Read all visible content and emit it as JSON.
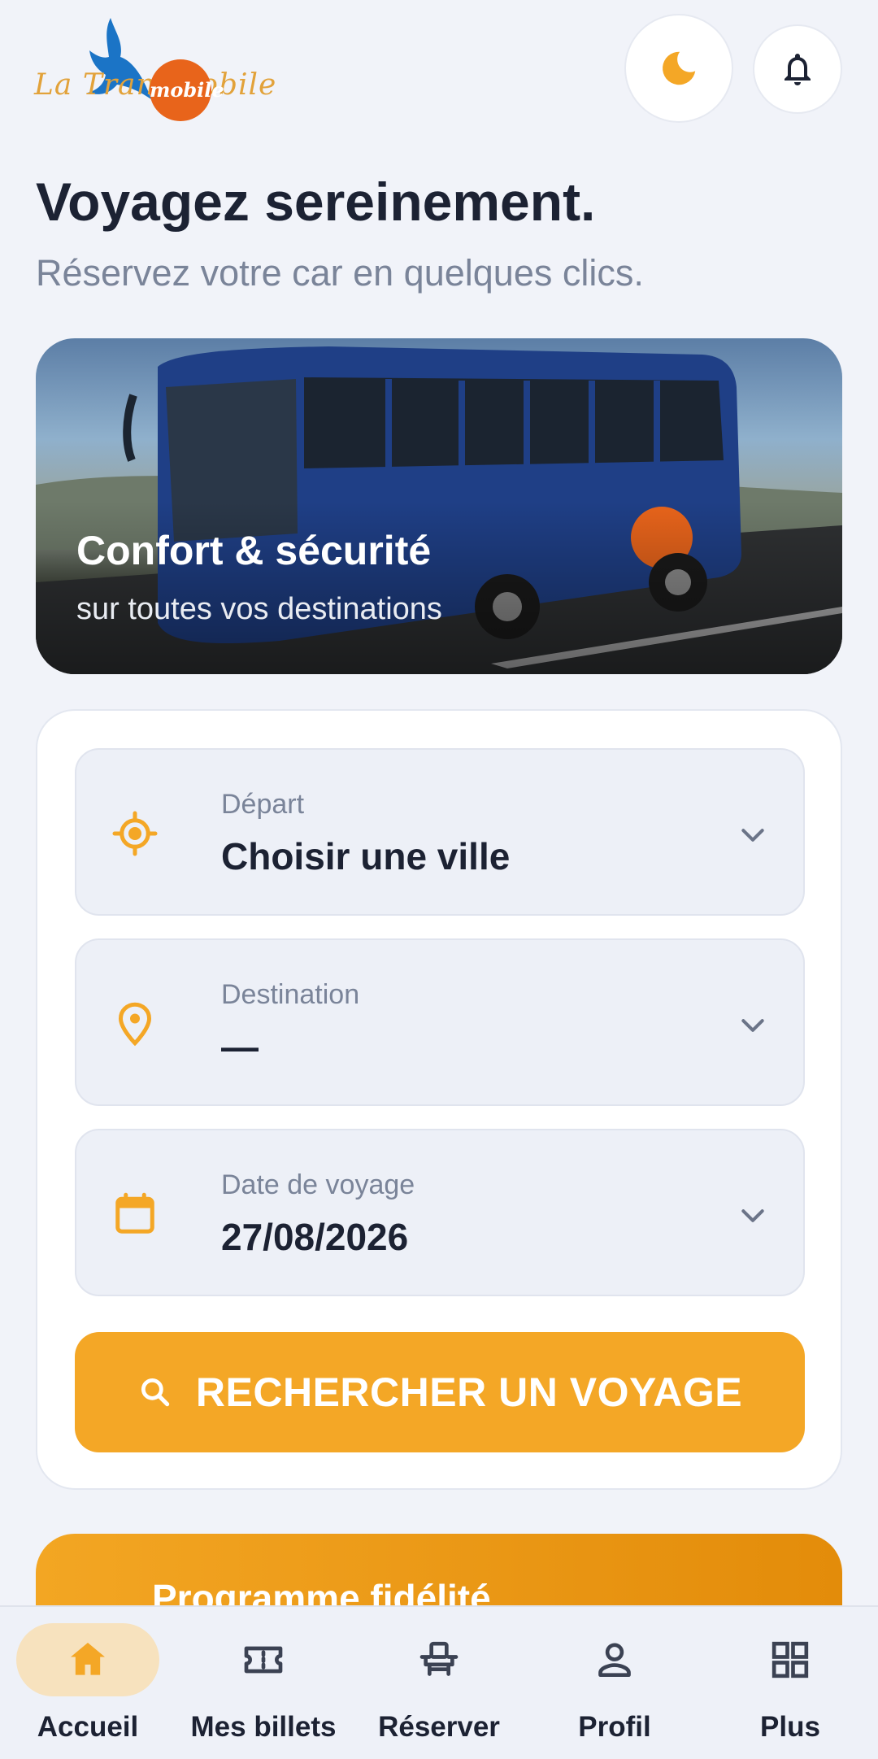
{
  "header": {
    "logo_text": "La Transmobile",
    "logo_badge": "mobile",
    "title": "Voyagez sereinement.",
    "subtitle": "Réservez votre car en quelques clics.",
    "theme_icon": "moon-icon",
    "notification_icon": "bell-icon"
  },
  "hero": {
    "title": "Confort & sécurité",
    "subtitle": "sur toutes vos destinations"
  },
  "form": {
    "departure": {
      "label": "Départ",
      "value": "Choisir une ville",
      "icon": "crosshair-icon"
    },
    "destination": {
      "label": "Destination",
      "value": "—",
      "icon": "location-pin-icon"
    },
    "date": {
      "label": "Date de voyage",
      "value": "27/08/2026",
      "icon": "calendar-icon"
    },
    "search_label": "RECHERCHER UN VOYAGE"
  },
  "fidelity": {
    "title": "Programme fidélité"
  },
  "nav": {
    "items": [
      {
        "label": "Accueil",
        "icon": "home-icon",
        "active": true
      },
      {
        "label": "Mes billets",
        "icon": "ticket-icon",
        "active": false
      },
      {
        "label": "Réserver",
        "icon": "seat-icon",
        "active": false
      },
      {
        "label": "Profil",
        "icon": "person-icon",
        "active": false
      },
      {
        "label": "Plus",
        "icon": "grid-icon",
        "active": false
      }
    ]
  },
  "colors": {
    "accent": "#f4a726",
    "accent_dark": "#e38c0a",
    "background": "#f1f3f9",
    "text": "#1c2233",
    "muted": "#7a8499",
    "nav_active_pill": "#f7e2be"
  }
}
